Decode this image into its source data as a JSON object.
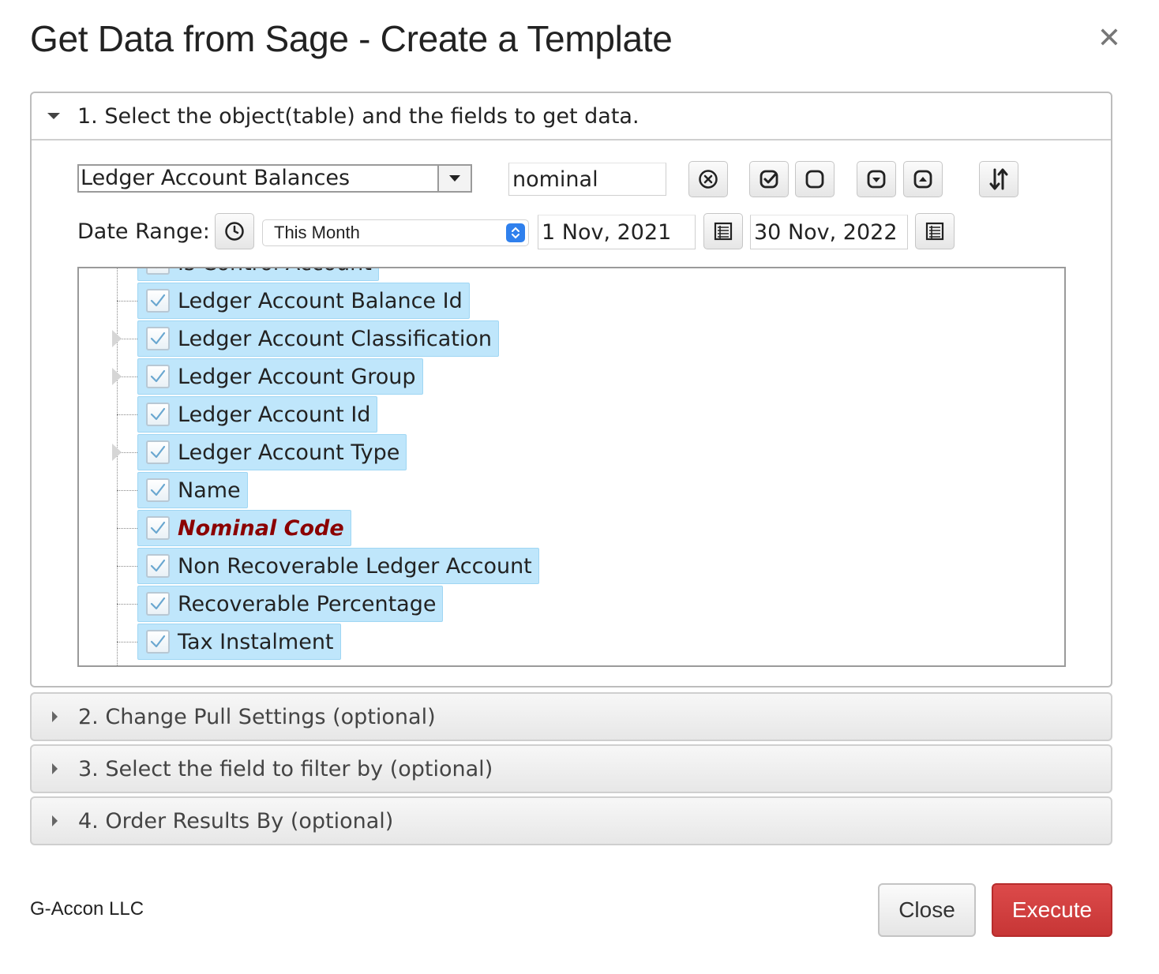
{
  "dialog": {
    "title": "Get Data from Sage - Create a Template",
    "close_icon": "close-x-icon"
  },
  "section1": {
    "header": "1. Select the object(table) and the fields to get data.",
    "object_select": {
      "value": "Ledger Account Balances"
    },
    "search": {
      "value": "nominal"
    },
    "toolbar_icons": [
      "clear-search-icon",
      "check-all-icon",
      "uncheck-all-icon",
      "expand-all-icon",
      "collapse-all-icon",
      "sort-icon"
    ],
    "date_range": {
      "label": "Date Range:",
      "clock_icon": "clock-icon",
      "preset": "This Month",
      "start": "1 Nov, 2021",
      "end": "30 Nov, 2022",
      "calendar_icon": "calendar-icon"
    },
    "fields": [
      {
        "label": "Is Control Account",
        "checked": true,
        "expandable": false
      },
      {
        "label": "Ledger Account Balance Id",
        "checked": true,
        "expandable": false
      },
      {
        "label": "Ledger Account Classification",
        "checked": true,
        "expandable": true
      },
      {
        "label": "Ledger Account Group",
        "checked": true,
        "expandable": true
      },
      {
        "label": "Ledger Account Id",
        "checked": true,
        "expandable": false
      },
      {
        "label": "Ledger Account Type",
        "checked": true,
        "expandable": true
      },
      {
        "label": "Name",
        "checked": true,
        "expandable": false
      },
      {
        "label": "Nominal Code",
        "checked": true,
        "expandable": false,
        "highlighted": true
      },
      {
        "label": "Non Recoverable Ledger Account",
        "checked": true,
        "expandable": false
      },
      {
        "label": "Recoverable Percentage",
        "checked": true,
        "expandable": false
      },
      {
        "label": "Tax Instalment",
        "checked": true,
        "expandable": false
      }
    ]
  },
  "sections": [
    {
      "label": "2. Change Pull Settings (optional)"
    },
    {
      "label": "3. Select the field to filter by (optional)"
    },
    {
      "label": "4. Order Results By (optional)"
    }
  ],
  "footer": {
    "brand": "G-Accon LLC",
    "close_label": "Close",
    "execute_label": "Execute"
  },
  "colors": {
    "node_bg": "#bfe6fb",
    "key_field": "#8b0000",
    "execute": "#cf3b3b",
    "stepper": "#2f80ed"
  }
}
